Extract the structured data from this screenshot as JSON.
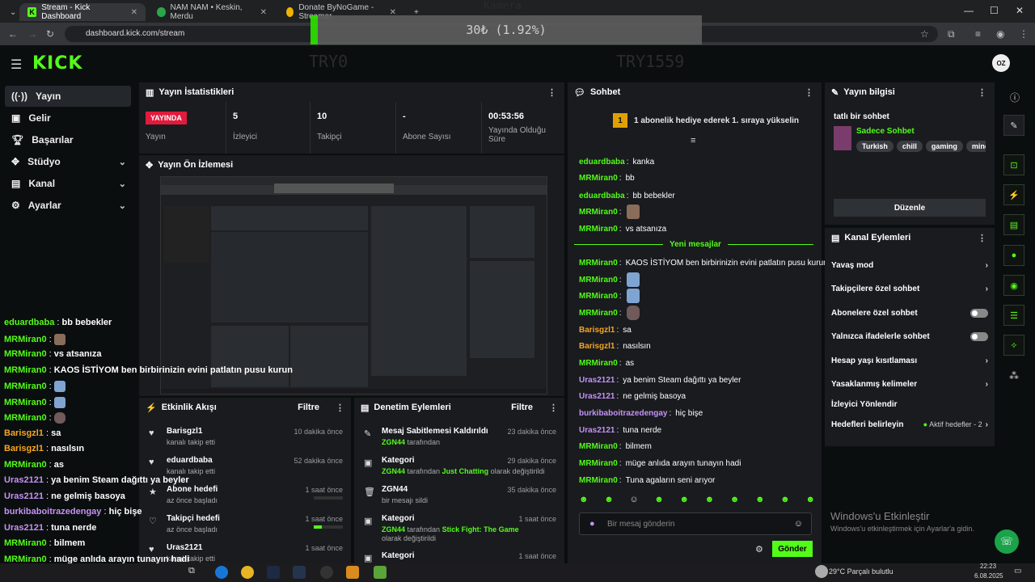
{
  "browser": {
    "tabs": [
      {
        "label": "Stream - Kick Dashboard"
      },
      {
        "label": "NAM NAM • Keskin, Merdu"
      },
      {
        "label": "Donate ByNoGame - Streamer"
      }
    ],
    "url": "dashboard.kick.com/stream"
  },
  "overlay": {
    "camera_label": "Kamera",
    "goal_text": "30₺ (1.92%)",
    "goal_progress_percent": 1.92,
    "left_name": "TRY0",
    "right_name": "TRY1559"
  },
  "header": {
    "logo": "KICK",
    "avatar_initials": "OZ"
  },
  "sidebar": {
    "items": [
      {
        "label": "Yayın"
      },
      {
        "label": "Gelir"
      },
      {
        "label": "Başarılar"
      },
      {
        "label": "Stüdyo"
      },
      {
        "label": "Kanal"
      },
      {
        "label": "Ayarlar"
      }
    ]
  },
  "stats": {
    "title": "Yayın İstatistikleri",
    "live_badge": "YAYINDA",
    "yayin_label": "Yayın",
    "viewers": "5",
    "viewers_label": "İzleyici",
    "followers": "10",
    "followers_label": "Takipçi",
    "subs": "-",
    "subs_label": "Abone Sayısı",
    "duration": "00:53:56",
    "duration_label": "Yayında Olduğu Süre"
  },
  "preview": {
    "title": "Yayın Ön İzlemesi"
  },
  "activity": {
    "title": "Etkinlik Akışı",
    "filter": "Filtre",
    "items": [
      {
        "title": "Barisgzl1",
        "sub": "kanalı takip etti",
        "time": "10 dakika önce"
      },
      {
        "title": "eduardbaba",
        "sub": "kanalı takip etti",
        "time": "52 dakika önce"
      },
      {
        "title": "Abone hedefi",
        "sub": "az önce başladı",
        "time": "1 saat önce"
      },
      {
        "title": "Takipçi hedefi",
        "sub": "az önce başladı",
        "time": "1 saat önce"
      },
      {
        "title": "Uras2121",
        "sub": "kanalı takip etti",
        "time": "1 saat önce"
      }
    ]
  },
  "moderation": {
    "title": "Denetim Eylemleri",
    "filter": "Filtre",
    "items": [
      {
        "title": "Mesaj Sabitlemesi Kaldırıldı",
        "user": "ZGN44",
        "mid": "tarafından",
        "time": "23 dakika önce"
      },
      {
        "title": "Kategori",
        "user": "ZGN44",
        "mid": "tarafından",
        "cat": "Just Chatting",
        "tail": "olarak değiştirildi",
        "time": "29 dakika önce"
      },
      {
        "title": "ZGN44",
        "sub": "bir mesajı sildi",
        "time": "35 dakika önce"
      },
      {
        "title": "Kategori",
        "user": "ZGN44",
        "mid": "tarafından",
        "cat": "Stick Fight: The Game",
        "tail": "olarak değiştirildi",
        "time": "1 saat önce"
      },
      {
        "title": "Kategori",
        "time": "1 saat önce"
      }
    ]
  },
  "chat": {
    "title": "Sohbet",
    "pinned": "1 abonelik hediye ederek 1. sıraya yükselin",
    "new_messages": "Yeni mesajlar",
    "placeholder": "Bir mesaj gönderin",
    "send": "Gönder",
    "messages": [
      {
        "user": "eduardbaba",
        "text": "kanka"
      },
      {
        "user": "MRMiran0",
        "text": "bb"
      },
      {
        "user": "eduardbaba",
        "text": "bb bebekler"
      },
      {
        "user": "MRMiran0",
        "text": ""
      },
      {
        "user": "MRMiran0",
        "text": "vs atsanıza"
      },
      {
        "user": "MRMiran0",
        "text": "KAOS İSTİYOM ben birbirinizin evini patlatın pusu kurun"
      },
      {
        "user": "MRMiran0",
        "text": ""
      },
      {
        "user": "MRMiran0",
        "text": ""
      },
      {
        "user": "MRMiran0",
        "text": ""
      },
      {
        "user": "Barisgzl1",
        "text": "sa"
      },
      {
        "user": "Barisgzl1",
        "text": "nasılsın"
      },
      {
        "user": "MRMiran0",
        "text": "as"
      },
      {
        "user": "Uras2121",
        "text": "ya benim Steam dağıttı ya beyler"
      },
      {
        "user": "Uras2121",
        "text": "ne gelmiş basoya"
      },
      {
        "user": "burkibaboitrazedengay",
        "text": "hiç bişe"
      },
      {
        "user": "Uras2121",
        "text": "tuna nerde"
      },
      {
        "user": "MRMiran0",
        "text": "bilmem"
      },
      {
        "user": "MRMiran0",
        "text": "müge anlıda arayın tunayın hadi"
      },
      {
        "user": "MRMiran0",
        "text": "Tuna agaların seni arıyor"
      }
    ]
  },
  "overlay_chat": [
    {
      "user": "eduardbaba",
      "text": "bb bebekler"
    },
    {
      "user": "MRMiran0",
      "text": ""
    },
    {
      "user": "MRMiran0",
      "text": "vs atsanıza"
    },
    {
      "user": "MRMiran0",
      "text": "KAOS İSTİYOM ben birbirinizin evini patlatın pusu kurun"
    },
    {
      "user": "MRMiran0",
      "text": ""
    },
    {
      "user": "MRMiran0",
      "text": ""
    },
    {
      "user": "MRMiran0",
      "text": ""
    },
    {
      "user": "Barisgzl1",
      "text": "sa"
    },
    {
      "user": "Barisgzl1",
      "text": "nasılsın"
    },
    {
      "user": "MRMiran0",
      "text": "as"
    },
    {
      "user": "Uras2121",
      "text": "ya benim Steam dağıttı ya beyler"
    },
    {
      "user": "Uras2121",
      "text": "ne gelmiş basoya"
    },
    {
      "user": "burkibaboitrazedengay",
      "text": "hiç bişe"
    },
    {
      "user": "Uras2121",
      "text": "tuna nerde"
    },
    {
      "user": "MRMiran0",
      "text": "bilmem"
    },
    {
      "user": "MRMiran0",
      "text": "müge anlıda arayın tunayın hadi"
    },
    {
      "user": "MRMiran0",
      "text": "Tuna agaların seni arıyor"
    }
  ],
  "info": {
    "title": "Yayın bilgisi",
    "stream_title": "tatlı bir sohbet",
    "category": "Sadece Sohbet",
    "tags": [
      "Turkish",
      "chill",
      "gaming",
      "minecraf"
    ],
    "edit": "Düzenle"
  },
  "channel_actions": {
    "title": "Kanal Eylemleri",
    "rows": [
      {
        "label": "Yavaş mod"
      },
      {
        "label": "Takipçilere özel sohbet"
      },
      {
        "label": "Abonelere özel sohbet"
      },
      {
        "label": "Yalnızca ifadelerle sohbet"
      },
      {
        "label": "Hesap yaşı kısıtlaması"
      },
      {
        "label": "Yasaklanmış kelimeler"
      },
      {
        "label": "İzleyici Yönlendir"
      },
      {
        "label": "Hedefleri belirleyin"
      }
    ],
    "goals_status": "Aktif hedefler - 2"
  },
  "watermark": {
    "title": "Windows'u Etkinleştir",
    "sub": "Windows'u etkinleştirmek için Ayarlar'a gidin."
  },
  "taskbar": {
    "weather": "29°C  Parçalı bulutlu",
    "time": "22:23",
    "date": "6.08.2025"
  },
  "colors": {
    "accent": "#53fc18",
    "live": "#e01b3c"
  }
}
